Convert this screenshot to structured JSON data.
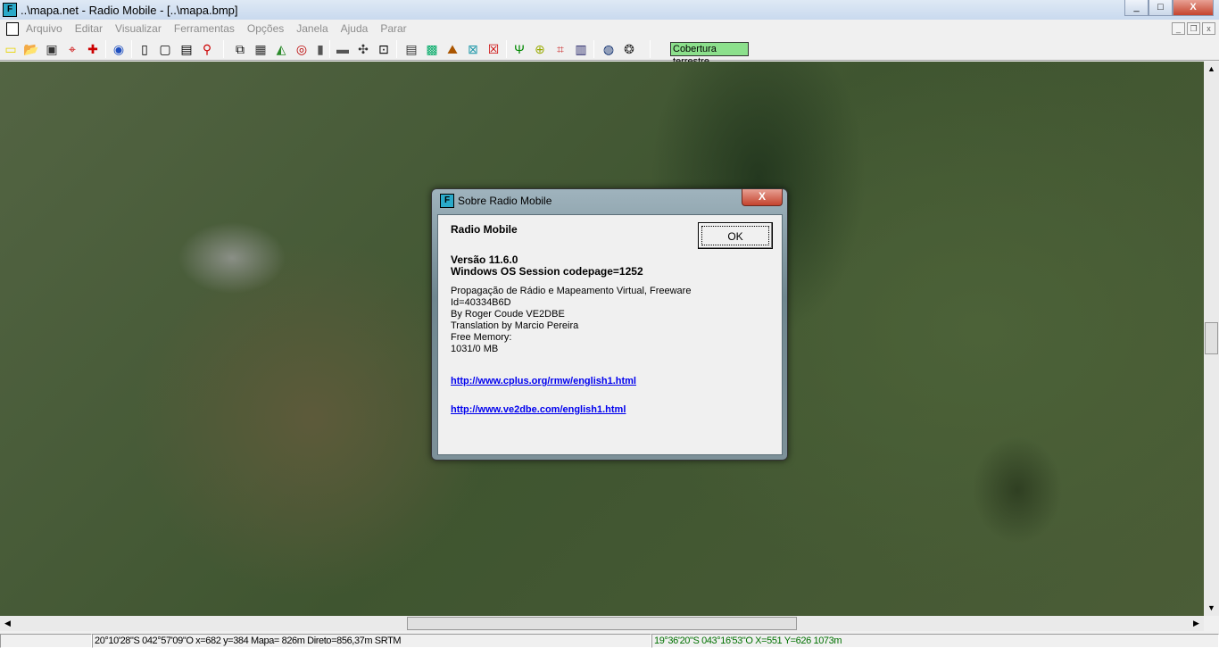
{
  "window": {
    "title": "..\\mapa.net - Radio Mobile - [..\\mapa.bmp]",
    "minimize": "_",
    "maximize": "□",
    "close": "X"
  },
  "menu": [
    "Arquivo",
    "Editar",
    "Visualizar",
    "Ferramentas",
    "Opções",
    "Janela",
    "Ajuda",
    "Parar"
  ],
  "toolbar": {
    "coverage_label": "Cobertura terrestre",
    "icons": [
      "new-folder-icon",
      "open-folder-icon",
      "save-icon",
      "network-properties-icon",
      "add-unit-icon",
      "radio-link-icon",
      "new-picture-icon",
      "open-picture-icon",
      "save-picture-icon",
      "unit-properties-icon",
      "copy-icon",
      "paste-icon",
      "map-properties-icon",
      "target-icon",
      "gradient-icon",
      "ruler-icon",
      "merge-icon",
      "fit-icon",
      "table-icon",
      "world-map-icon",
      "elevation-icon",
      "selection-icon",
      "cancel-selection-icon",
      "antenna-icon",
      "coverage-icon",
      "route-icon",
      "spectrum-icon",
      "globe-icon",
      "wireframe-icon"
    ]
  },
  "status": {
    "left": "20°10'28\"S  042°57'09\"O   x=682 y=384 Mapa= 826m Direto=856,37m SRTM",
    "right": "19°36'20\"S 043°16'53\"O  X=551 Y=626 1073m"
  },
  "dialog": {
    "title": "Sobre Radio Mobile",
    "close": "X",
    "ok": "OK",
    "app": "Radio Mobile",
    "version": "Versão 11.6.0",
    "session": "Windows OS Session codepage=1252",
    "lines": [
      "Propagação de Rádio e Mapeamento Virtual, Freeware",
      "Id=40334B6D",
      "By Roger Coude VE2DBE",
      "Translation by Marcio Pereira",
      "Free Memory:",
      "1031/0 MB"
    ],
    "links": [
      "http://www.cplus.org/rmw/english1.html",
      "http://www.ve2dbe.com/english1.html"
    ]
  }
}
